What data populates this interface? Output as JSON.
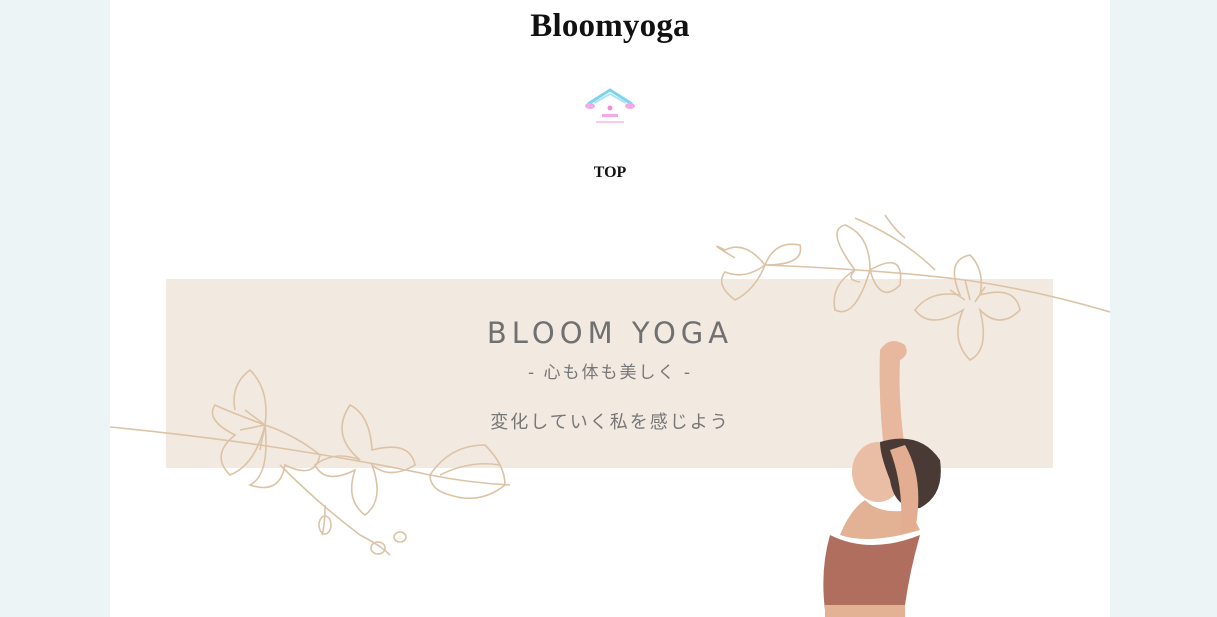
{
  "site": {
    "title": "Bloomyoga",
    "logo_icon": "house-flower-logo",
    "nav": {
      "top_label": "TOP"
    }
  },
  "hero": {
    "title": "BLOOM YOGA",
    "subtitle": "- 心も体も美しく -",
    "tagline": "変化していく私を感じよう",
    "band_color": "#f2e9e1",
    "illustration_color": "#dcc3a6"
  },
  "colors": {
    "background": "#ecf4f5",
    "page": "#ffffff",
    "text": "#707070"
  }
}
